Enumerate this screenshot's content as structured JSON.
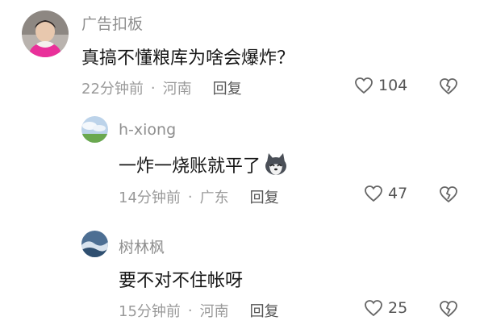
{
  "comments": [
    {
      "username": "广告扣板",
      "content": "真搞不懂粮库为啥会爆炸？",
      "time": "22分钟前",
      "separator": "·",
      "location": "河南",
      "reply_label": "回复",
      "likes": "104",
      "avatar_icon": "child-photo-avatar"
    },
    {
      "username": "h-xiong",
      "content": "一炸一烧账就平了",
      "content_emoji": "husky-dog-emoji",
      "time": "14分钟前",
      "separator": "·",
      "location": "广东",
      "reply_label": "回复",
      "likes": "47",
      "avatar_icon": "sky-landscape-avatar"
    },
    {
      "username": "树林枫",
      "content": "要不对不住帐呀",
      "time": "15分钟前",
      "separator": "·",
      "location": "河南",
      "reply_label": "回复",
      "likes": "25",
      "avatar_icon": "ocean-wave-avatar"
    }
  ]
}
